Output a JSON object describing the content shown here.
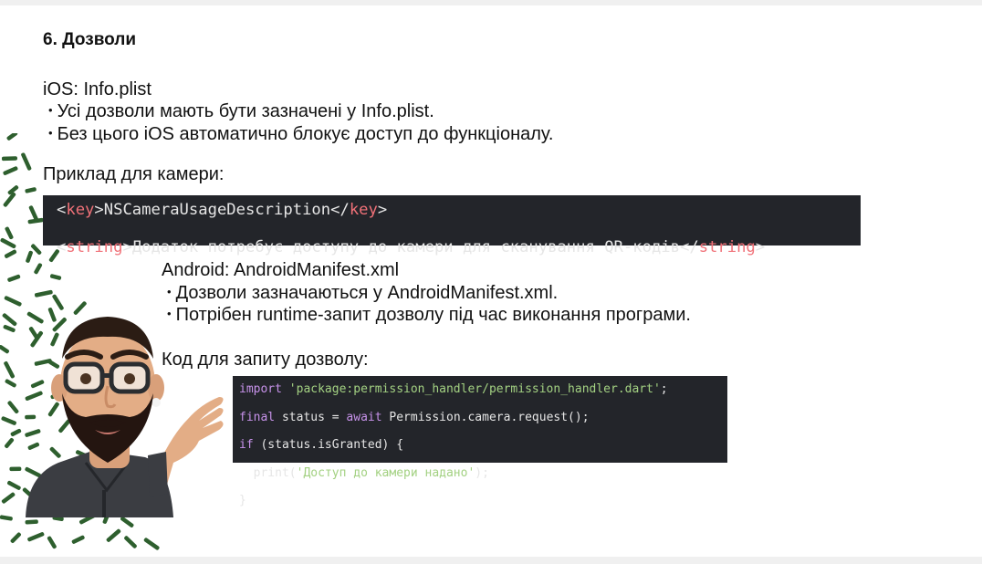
{
  "slide": {
    "heading": "6. Дозволи",
    "ios": {
      "title": "iOS: Info.plist",
      "bullets": [
        "Усі дозволи мають бути зазначені у Info.plist.",
        "Без цього iOS автоматично блокує доступ до функціоналу."
      ],
      "example_label": "Приклад для камери:",
      "code": {
        "line1": {
          "open_bracket": "<",
          "open_tag": "key",
          "close_bracket": ">",
          "content": "NSCameraUsageDescription",
          "end_bracket": "</",
          "end_tag": "key",
          "end_close": ">"
        },
        "line2": {
          "open_bracket": "<",
          "open_tag": "string",
          "close_bracket": ">",
          "content": "Додаток потребує доступу до камери для сканування QR-кодів",
          "end_bracket": "</",
          "end_tag": "string",
          "end_close": ">"
        }
      }
    },
    "android": {
      "title": "Android: AndroidManifest.xml",
      "bullets": [
        "Дозволи зазначаються у AndroidManifest.xml.",
        "Потрібен runtime-запит дозволу під час виконання програми."
      ],
      "code_label": "Код для запиту дозволу:",
      "code": {
        "l1_kw": "import",
        "l1_str": "'package:permission_handler/permission_handler.dart'",
        "l1_end": ";",
        "l2_kw": "final",
        "l2_mid": " status = ",
        "l2_kw2": "await",
        "l2_end": " Permission.camera.request();",
        "l3_kw": "if",
        "l3_end": " (status.isGranted) {",
        "l4_start": "  print(",
        "l4_str": "'Доступ до камери надано'",
        "l4_end": ");",
        "l5": "}"
      }
    }
  },
  "colors": {
    "code_background": "#23252a",
    "xml_tag": "#f07178",
    "keyword": "#c792ea",
    "string": "#a3d182",
    "leaf_green": "#2e5f2e"
  },
  "icons": {
    "decoration": "leaf-pattern",
    "presenter": "memoji-avatar"
  }
}
